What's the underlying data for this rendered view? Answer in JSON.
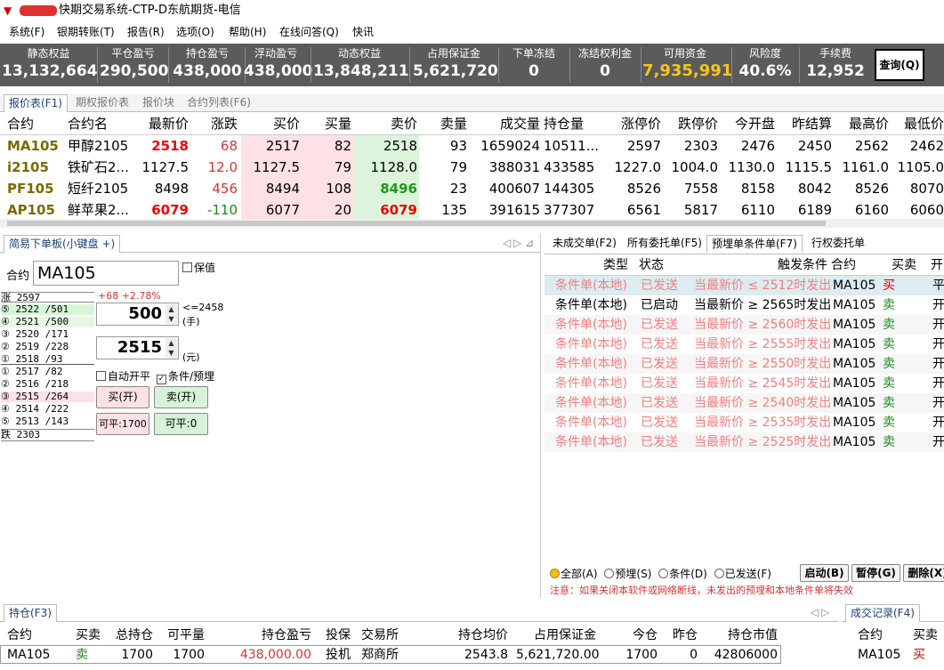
{
  "titlebar": {
    "title": "快期交易系统-CTP-D东航期货-电信"
  },
  "menu": [
    "系统(F)",
    "银期转账(T)",
    "报告(R)",
    "选项(O)",
    "帮助(H)",
    "在线问答(Q)",
    "快讯"
  ],
  "account": {
    "items": [
      {
        "label": "静态权益",
        "value": "13,132,664"
      },
      {
        "label": "平仓盈亏",
        "value": "290,500"
      },
      {
        "label": "持仓盈亏",
        "value": "438,000"
      },
      {
        "label": "浮动盈亏",
        "value": "438,000"
      },
      {
        "label": "动态权益",
        "value": "13,848,211"
      },
      {
        "label": "占用保证金",
        "value": "5,621,720"
      },
      {
        "label": "下单冻结",
        "value": "0"
      },
      {
        "label": "冻结权利金",
        "value": "0"
      },
      {
        "label": "可用资金",
        "value": "7,935,991"
      },
      {
        "label": "风险度",
        "value": "40.6%"
      },
      {
        "label": "手续费",
        "value": "12,952"
      }
    ],
    "query_button": "查询(Q)"
  },
  "quote_tabs": [
    "报价表(F1)",
    "期权报价表",
    "报价块",
    "合约列表(F6)"
  ],
  "quote": {
    "headers": [
      "合约",
      "合约名",
      "最新价",
      "涨跌",
      "买价",
      "买量",
      "卖价",
      "卖量",
      "成交量",
      "持仓量",
      "涨停价",
      "跌停价",
      "今开盘",
      "昨结算",
      "最高价",
      "最低价"
    ],
    "rows": [
      [
        "MA105",
        "甲醇2105",
        "2518",
        "68",
        "2517",
        "82",
        "2518",
        "93",
        "1659024",
        "10511...",
        "2597",
        "2303",
        "2476",
        "2450",
        "2562",
        "2462"
      ],
      [
        "i2105",
        "铁矿石2...",
        "1127.5",
        "12.0",
        "1127.5",
        "79",
        "1128.0",
        "79",
        "388031",
        "433585",
        "1227.0",
        "1004.0",
        "1130.0",
        "1115.5",
        "1161.0",
        "1105.0"
      ],
      [
        "PF105",
        "短纤2105",
        "8498",
        "456",
        "8494",
        "108",
        "8496",
        "23",
        "400607",
        "144305",
        "8526",
        "7558",
        "8158",
        "8042",
        "8526",
        "8070"
      ],
      [
        "AP105",
        "鲜苹果2...",
        "6079",
        "-110",
        "6077",
        "20",
        "6079",
        "135",
        "391615",
        "377307",
        "6561",
        "5817",
        "6110",
        "6189",
        "6160",
        "6060"
      ]
    ]
  },
  "order_panel": {
    "tab": "简易下单板(小键盘 +)",
    "contract_label": "合约",
    "contract_value": "MA105",
    "baozhi": "保值",
    "limit_up": "涨  2597",
    "change_info": "+68 +2.78%",
    "asks": [
      "⑤ 2522 /501",
      "④ 2521 /500",
      "③ 2520 /171",
      "② 2519 /228",
      "① 2518 /93"
    ],
    "bids": [
      "① 2517 /82",
      "② 2516 /218",
      "③ 2515 /264",
      "④ 2514 /222",
      "⑤ 2513 /143"
    ],
    "limit_down": "跌  2303",
    "qty": "500",
    "qty_note1": "<=2458",
    "qty_note2": "(手)",
    "price": "2515",
    "price_note": "(元)",
    "auto_open_close": "自动开平",
    "cond_preset": "条件/预埋",
    "buy_open": "买(开)",
    "sell_open": "卖(开)",
    "close_buy": "可平:1700",
    "close_sell": "可平:0"
  },
  "cond_tabs": [
    "未成交单(F2)",
    "所有委托单(F5)",
    "预埋单条件单(F7)",
    "行权委托单"
  ],
  "cond": {
    "headers": [
      "类型",
      "状态",
      "触发条件",
      "合约",
      "买卖",
      "开"
    ],
    "rows": [
      [
        "条件单(本地)",
        "已发送",
        "当最新价 ≤ 2512时发出",
        "MA105",
        "买",
        "平"
      ],
      [
        "条件单(本地)",
        "已启动",
        "当最新价 ≥ 2565时发出",
        "MA105",
        "卖",
        "开"
      ],
      [
        "条件单(本地)",
        "已发送",
        "当最新价 ≥ 2560时发出",
        "MA105",
        "卖",
        "开"
      ],
      [
        "条件单(本地)",
        "已发送",
        "当最新价 ≥ 2555时发出",
        "MA105",
        "卖",
        "开"
      ],
      [
        "条件单(本地)",
        "已发送",
        "当最新价 ≥ 2550时发出",
        "MA105",
        "卖",
        "开"
      ],
      [
        "条件单(本地)",
        "已发送",
        "当最新价 ≥ 2545时发出",
        "MA105",
        "卖",
        "开"
      ],
      [
        "条件单(本地)",
        "已发送",
        "当最新价 ≥ 2540时发出",
        "MA105",
        "卖",
        "开"
      ],
      [
        "条件单(本地)",
        "已发送",
        "当最新价 ≥ 2535时发出",
        "MA105",
        "卖",
        "开"
      ],
      [
        "条件单(本地)",
        "已发送",
        "当最新价 ≥ 2525时发出",
        "MA105",
        "卖",
        "开"
      ]
    ],
    "filters": [
      "全部(A)",
      "预埋(S)",
      "条件(D)",
      "已发送(F)"
    ],
    "buttons": [
      "启动(B)",
      "暂停(G)",
      "删除(X)"
    ],
    "notice": "注意：如果关闭本软件或网络断线，未发出的预埋和本地条件单将失效"
  },
  "positions": {
    "tab": "持仓(F3)",
    "headers": [
      "合约",
      "买卖",
      "总持仓",
      "可平量",
      "持仓盈亏",
      "投保",
      "交易所",
      "持仓均价",
      "占用保证金",
      "今仓",
      "昨仓",
      "持仓市值"
    ],
    "row": [
      "MA105",
      "卖",
      "1700",
      "1700",
      "438,000.00",
      "投机",
      "郑商所",
      "2543.8",
      "5,621,720.00",
      "1700",
      "0",
      "42806000"
    ]
  },
  "trades": {
    "tab": "成交记录(F4)",
    "headers": [
      "合约",
      "买卖"
    ],
    "row": [
      "MA105",
      "买"
    ]
  }
}
